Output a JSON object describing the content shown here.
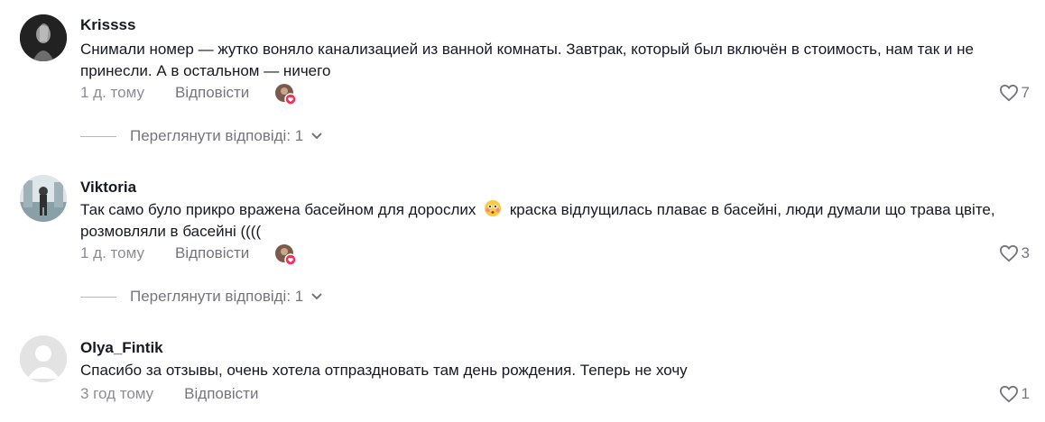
{
  "comments": [
    {
      "username": "Krissss",
      "text": "Снимали номер — жутко воняло канализацией из ванной комнаты. Завтрак, который был включён в стоимость, нам так и не принесли. А в остальном — ничего",
      "time": "1 д. тому",
      "reply_label": "Відповісти",
      "likes": "7",
      "view_replies": "Переглянути відповіді: 1"
    },
    {
      "username": "Viktoria",
      "text_before_emoji": "Так само було прикро вражена басейном для дорослих",
      "text_after_emoji": "краска відлущилась плаває в басейні, люди думали що трава цвіте, розмовляли в басейні ((((",
      "time": "1 д. тому",
      "reply_label": "Відповісти",
      "likes": "3",
      "view_replies": "Переглянути відповіді: 1"
    },
    {
      "username": "Olya_Fintik",
      "text": "Спасибо за отзывы, очень хотела отпраздновать там день рождения. Теперь не хочу",
      "time": "3 год тому",
      "reply_label": "Відповісти",
      "likes": "1"
    }
  ],
  "colors": {
    "creator_heart": "#fe2c55"
  }
}
